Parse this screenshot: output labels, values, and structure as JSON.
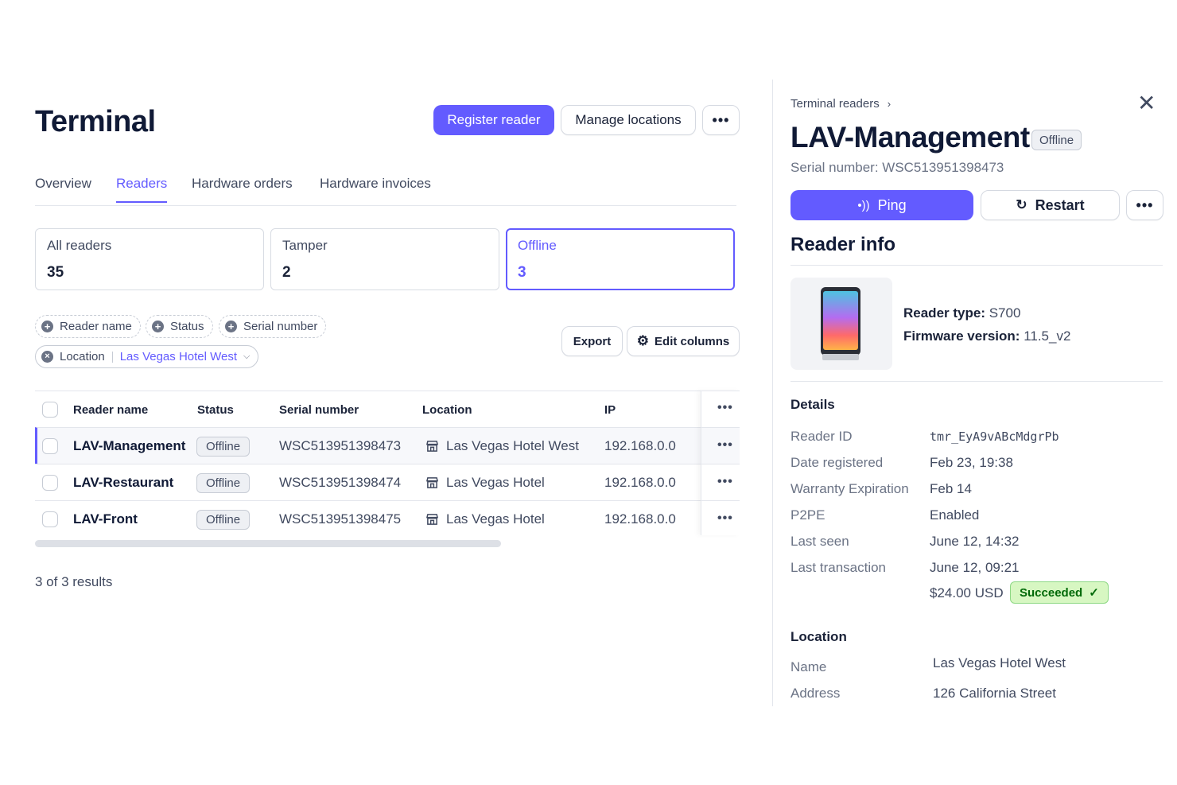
{
  "header": {
    "title": "Terminal",
    "register_label": "Register reader",
    "manage_label": "Manage locations",
    "more_label": "•••"
  },
  "tabs": [
    {
      "label": "Overview"
    },
    {
      "label": "Readers"
    },
    {
      "label": "Hardware orders"
    },
    {
      "label": "Hardware invoices"
    }
  ],
  "stats": [
    {
      "label": "All readers",
      "value": "35"
    },
    {
      "label": "Tamper",
      "value": "2"
    },
    {
      "label": "Offline",
      "value": "3"
    }
  ],
  "filters": {
    "reader_name": "Reader name",
    "status": "Status",
    "serial_number": "Serial number",
    "location_label": "Location",
    "location_value": "Las Vegas Hotel West"
  },
  "toolbar": {
    "export_label": "Export",
    "edit_columns_label": "Edit columns"
  },
  "table": {
    "columns": [
      "Reader name",
      "Status",
      "Serial number",
      "Location",
      "IP"
    ],
    "rows": [
      {
        "name": "LAV-Management",
        "status": "Offline",
        "serial": "WSC513951398473",
        "location": "Las Vegas Hotel West",
        "ip": "192.168.0.0"
      },
      {
        "name": "LAV-Restaurant",
        "status": "Offline",
        "serial": "WSC513951398474",
        "location": "Las Vegas Hotel",
        "ip": "192.168.0.0"
      },
      {
        "name": "LAV-Front",
        "status": "Offline",
        "serial": "WSC513951398475",
        "location": "Las Vegas Hotel",
        "ip": "192.168.0.0"
      }
    ],
    "row_more": "•••"
  },
  "results_text": "3 of 3 results",
  "detail": {
    "breadcrumb": "Terminal readers",
    "title": "LAV-Management",
    "status_badge": "Offline",
    "serial": "Serial number: WSC513951398473",
    "ping_label": "Ping",
    "restart_label": "Restart",
    "more_label": "•••",
    "reader_info_title": "Reader info",
    "reader_type_label": "Reader type:",
    "reader_type_value": "S700",
    "firmware_label": "Firmware version:",
    "firmware_value": "11.5_v2",
    "details_title": "Details",
    "details": [
      {
        "key": "Reader ID",
        "value": "tmr_EyA9vABcMdgrPb"
      },
      {
        "key": "Date registered",
        "value": "Feb 23, 19:38"
      },
      {
        "key": "Warranty Expiration",
        "value": "Feb 14"
      },
      {
        "key": "P2PE",
        "value": "Enabled"
      },
      {
        "key": "Last seen",
        "value": "June 12, 14:32"
      },
      {
        "key": "Last transaction",
        "value": "June 12, 09:21"
      }
    ],
    "transaction_amount": "$24.00 USD",
    "transaction_status": "Succeeded",
    "location_title": "Location",
    "location": [
      {
        "key": "Name",
        "value": "Las Vegas Hotel West"
      },
      {
        "key": "Address",
        "value": "126 California Street"
      }
    ]
  },
  "colors": {
    "accent": "#635bff",
    "success_bg": "#d7f7c2",
    "success_text": "#006908"
  }
}
